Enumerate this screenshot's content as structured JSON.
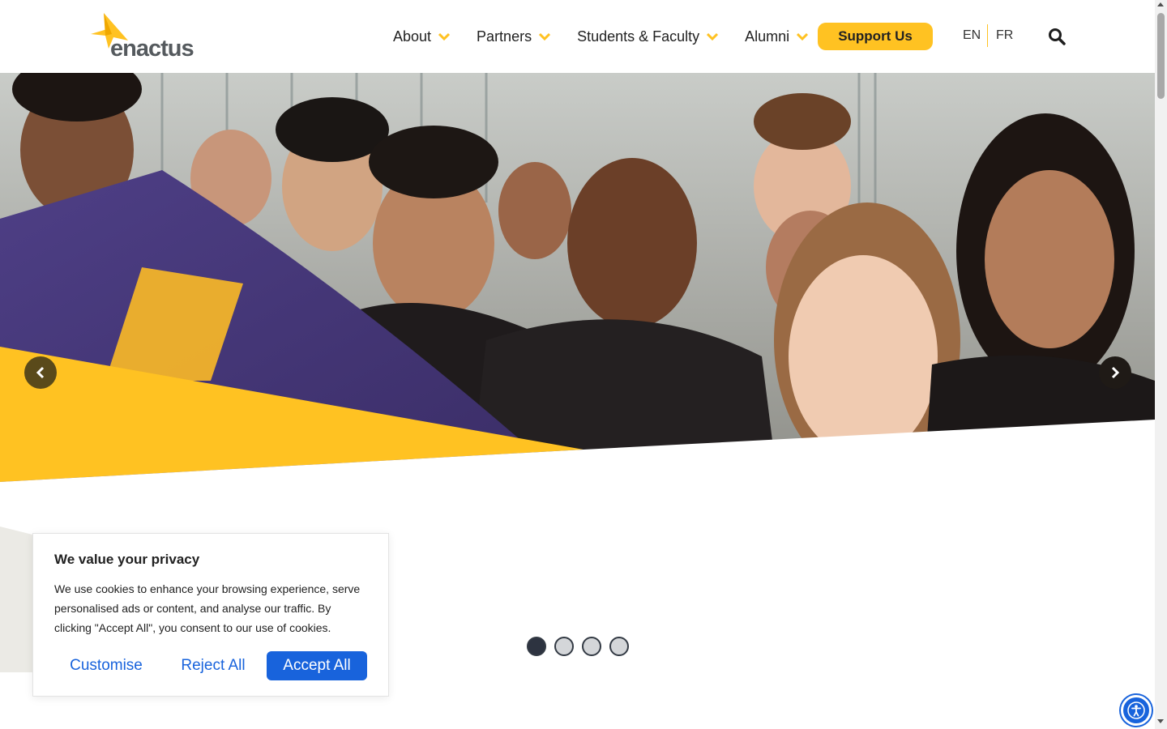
{
  "header": {
    "logo_text": "enactus",
    "nav": [
      {
        "label": "About"
      },
      {
        "label": "Partners"
      },
      {
        "label": "Students & Faculty"
      },
      {
        "label": "Alumni"
      }
    ],
    "support_label": "Support Us",
    "lang_en": "EN",
    "lang_fr": "FR",
    "icons": {
      "search": "search-icon",
      "chevron": "chevron-down-icon"
    }
  },
  "hero": {
    "slides_total": 4,
    "active_slide": 1,
    "icons": {
      "prev": "chevron-left-icon",
      "next": "chevron-right-icon"
    }
  },
  "cookie": {
    "title": "We value your privacy",
    "body": "We use cookies to enhance your browsing experience, serve personalised ads or content, and analyse our traffic. By clicking \"Accept All\", you consent to our use of cookies.",
    "customise": "Customise",
    "reject": "Reject All",
    "accept": "Accept All"
  },
  "colors": {
    "brand_yellow": "#ffc222",
    "logo_gray": "#555a5e",
    "cookie_blue": "#1863dc",
    "dot_active": "#2d3340"
  },
  "accessibility": {
    "icon": "accessibility-icon"
  }
}
